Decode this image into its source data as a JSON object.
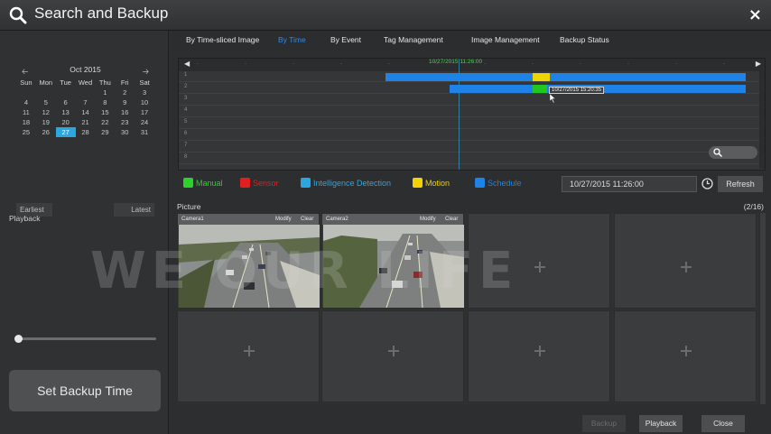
{
  "window": {
    "title": "Search and Backup",
    "close_label": "×"
  },
  "tabs": [
    {
      "label": "By Time-sliced Image",
      "active": false
    },
    {
      "label": "By Time",
      "active": true
    },
    {
      "label": "By Event",
      "active": false
    },
    {
      "label": "Tag Management",
      "active": false
    },
    {
      "label": "Image Management",
      "active": false
    },
    {
      "label": "Backup Status",
      "active": false
    }
  ],
  "calendar": {
    "prev_icon": "arrow-left-icon",
    "next_icon": "arrow-right-icon",
    "month_label": "Oct  2015",
    "weekdays": [
      "Sun",
      "Mon",
      "Tue",
      "Wed",
      "Thu",
      "Fri",
      "Sat"
    ],
    "selected_day": "27",
    "weeks": [
      [
        "",
        "",
        "",
        "",
        "1",
        "2",
        "3"
      ],
      [
        "4",
        "5",
        "6",
        "7",
        "8",
        "9",
        "10"
      ],
      [
        "11",
        "12",
        "13",
        "14",
        "15",
        "16",
        "17"
      ],
      [
        "18",
        "19",
        "20",
        "21",
        "22",
        "23",
        "24"
      ],
      [
        "25",
        "26",
        "27",
        "28",
        "29",
        "30",
        "31"
      ]
    ],
    "earliest_label": "Earliest",
    "latest_label": "Latest"
  },
  "playback_label": "Playback",
  "set_backup_label": "Set Backup Time",
  "timeline": {
    "cursor_time": "10/27/2015 11:26:00",
    "tooltip": "10/27/2015 15:20:35",
    "rows": [
      "1",
      "2",
      "3",
      "4",
      "5",
      "6",
      "7",
      "8"
    ],
    "colors": {
      "normal": "#1e82e6",
      "motion": "#f0d400",
      "manual": "#22c822"
    }
  },
  "legend": {
    "manual": {
      "label": "Manual",
      "color": "#2bd22b",
      "icon": "hand-icon"
    },
    "sensor": {
      "label": "Sensor",
      "color": "#e21f1f",
      "icon": "sensor-icon"
    },
    "intelligence": {
      "label": "Intelligence Detection",
      "color": "#2aa7e0",
      "icon": "intelligence-icon"
    },
    "motion": {
      "label": "Motion",
      "color": "#f2d200",
      "icon": "motion-icon"
    },
    "schedule": {
      "label": "Schedule",
      "color": "#1e82e6",
      "icon": "schedule-icon"
    },
    "datetime": "10/27/2015 11:26:00",
    "refresh_label": "Refresh"
  },
  "pictures": {
    "label": "Picture",
    "count": "(2/16)",
    "cells": [
      {
        "camera": "Camera1",
        "modify": "Modify",
        "clear": "Clear"
      },
      {
        "camera": "Camera2",
        "modify": "Modify",
        "clear": "Clear"
      }
    ]
  },
  "bottom": {
    "backup_label": "Backup",
    "playback_label": "Playback",
    "close_label": "Close"
  },
  "watermark": "WE        OUR LIFE"
}
